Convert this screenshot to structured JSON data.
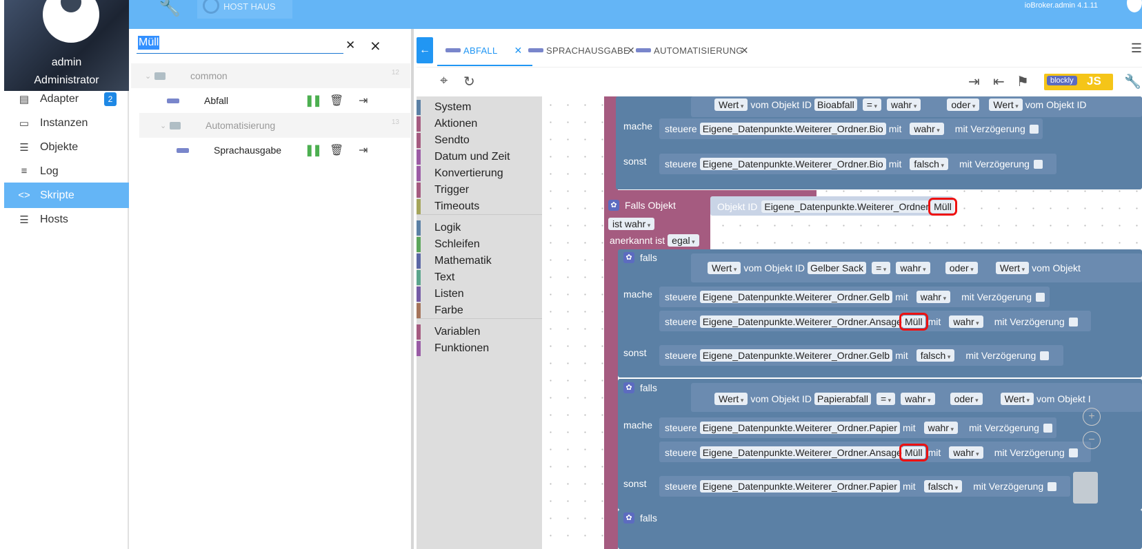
{
  "topbar": {
    "host_label": "HOST HAUS",
    "version": "ioBroker.admin 4.1.11"
  },
  "user": {
    "name": "admin",
    "role": "Administrator"
  },
  "nav": [
    {
      "label": "Adapter",
      "icon": "store-icon",
      "badge": "2"
    },
    {
      "label": "Instanzen",
      "icon": "instances-icon"
    },
    {
      "label": "Objekte",
      "icon": "list-icon"
    },
    {
      "label": "Log",
      "icon": "log-icon"
    },
    {
      "label": "Skripte",
      "icon": "code-icon",
      "active": true
    },
    {
      "label": "Hosts",
      "icon": "hosts-icon"
    }
  ],
  "search": {
    "value": "Müll"
  },
  "tree": {
    "common": {
      "label": "common",
      "count": "12"
    },
    "abfall": {
      "label": "Abfall"
    },
    "automatisierung": {
      "label": "Automatisierung",
      "count": "13"
    },
    "sprachausgabe": {
      "label": "Sprachausgabe"
    }
  },
  "tabs": [
    {
      "label": "ABFALL",
      "active": true
    },
    {
      "label": "SPRACHAUSGABE"
    },
    {
      "label": "AUTOMATISIERUNG"
    }
  ],
  "toolbar": {
    "blockly": "blockly",
    "js": "JS"
  },
  "toolbox": {
    "group1": [
      "System",
      "Aktionen",
      "Sendto",
      "Datum und Zeit",
      "Konvertierung",
      "Trigger",
      "Timeouts"
    ],
    "group2": [
      "Logik",
      "Schleifen",
      "Mathematik",
      "Text",
      "Listen",
      "Farbe"
    ],
    "group3": [
      "Variablen",
      "Funktionen"
    ],
    "colors": [
      "#5b80a5",
      "#a55b80",
      "#a55b80",
      "#9c5ba5",
      "#9c5ba5",
      "#a55b80",
      "#a5a55b",
      "#5b80a5",
      "#5ba55b",
      "#5b67a5",
      "#5ba58c",
      "#745ba5",
      "#a5745b",
      "#a55b80",
      "#995ba5"
    ]
  },
  "blocks": {
    "w": "Wert",
    "vom": "vom Objekt ID",
    "eq": "=",
    "wahr": "wahr",
    "falsch": "falsch",
    "oder": "oder",
    "mache": "mache",
    "sonst": "sonst",
    "falls": "falls",
    "steuere": "steuere",
    "mit": "mit",
    "delay": "mit Verzögerung",
    "bioabfall": "Bioabfall",
    "bio": "Eigene_Datenpunkte.Weiterer_Ordner.Bio",
    "trigger_title": "Falls Objekt",
    "objekt_id": "Objekt ID",
    "objekt_prefix": "Eigene_Datenpunkte.Weiterer_Ordner.",
    "muell": "Müll",
    "ist_wahr": "ist wahr",
    "anerkannt": "anerkannt ist",
    "egal": "egal",
    "gelber_sack": "Gelber Sack",
    "gelb": "Eigene_Datenpunkte.Weiterer_Ordner.Gelb",
    "ansage": "Eigene_Datenpunkte.Weiterer_Ordner.Ansage",
    "papierabfall": "Papierabfall",
    "papier": "Eigene_Datenpunkte.Weiterer_Ordner.Papier",
    "vom_short": "vom Objekt",
    "vom_cut": "vom Objekt I"
  }
}
